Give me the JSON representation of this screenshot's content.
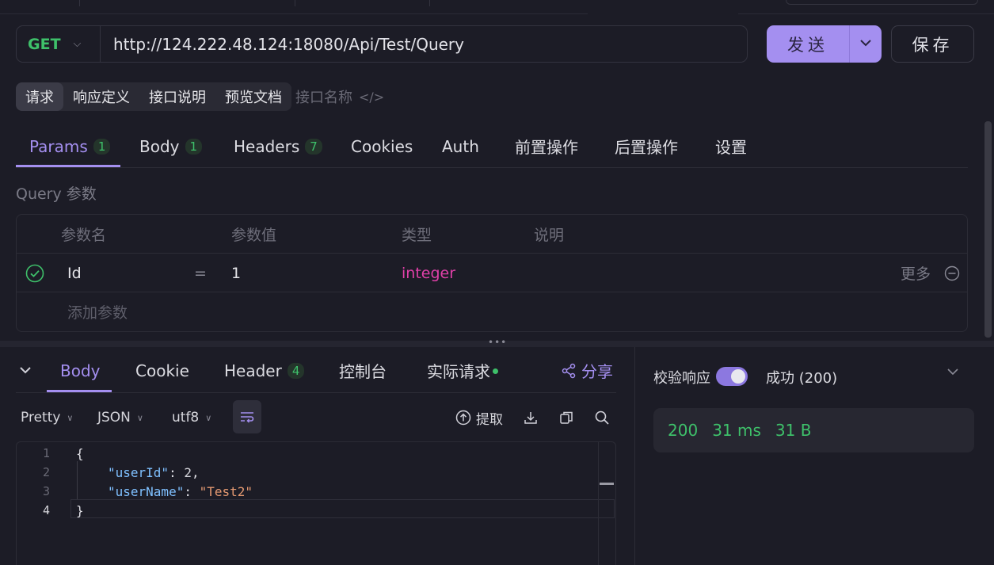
{
  "request": {
    "method": "GET",
    "url": "http://124.222.48.124:18080/Api/Test/Query",
    "send_label": "发送",
    "save_label": "保存"
  },
  "segments": [
    {
      "label": "请求",
      "active": true
    },
    {
      "label": "响应定义",
      "active": false
    },
    {
      "label": "接口说明",
      "active": false
    },
    {
      "label": "预览文档",
      "active": false
    }
  ],
  "api_name_placeholder": "接口名称",
  "req_tabs": [
    {
      "label": "Params",
      "badge": "1",
      "active": true
    },
    {
      "label": "Body",
      "badge": "1"
    },
    {
      "label": "Headers",
      "badge": "7"
    },
    {
      "label": "Cookies"
    },
    {
      "label": "Auth"
    },
    {
      "label": "前置操作"
    },
    {
      "label": "后置操作"
    },
    {
      "label": "设置"
    }
  ],
  "query_label": "Query 参数",
  "params": {
    "headers": [
      "参数名",
      "参数值",
      "类型",
      "说明"
    ],
    "rows": [
      {
        "name": "Id",
        "eq": "=",
        "value": "1",
        "type": "integer",
        "more": "更多"
      }
    ],
    "add_label": "添加参数"
  },
  "resp_tabs": [
    {
      "label": "Body",
      "active": true
    },
    {
      "label": "Cookie"
    },
    {
      "label": "Header",
      "badge": "4"
    },
    {
      "label": "控制台"
    },
    {
      "label": "实际请求"
    }
  ],
  "share_label": "分享",
  "toolbar": {
    "format": "Pretty",
    "lang": "JSON",
    "encoding": "utf8",
    "extract_label": "提取"
  },
  "code_lines": [
    {
      "num": "1"
    },
    {
      "num": "2",
      "key": "\"userId\"",
      "value": "2"
    },
    {
      "num": "3",
      "key": "\"userName\"",
      "value": "\"Test2\""
    },
    {
      "num": "4"
    }
  ],
  "code_punct": {
    "open": "{",
    "close": "}",
    "colon": ": ",
    "comma": ","
  },
  "validation": {
    "label": "校验响应",
    "enabled": true,
    "status": "成功 (200)"
  },
  "stats": {
    "code": "200",
    "time": "31 ms",
    "size": "31 B"
  },
  "colors": {
    "accent": "#a48ff0",
    "success": "#3ec06a",
    "type": "#e040a8"
  }
}
